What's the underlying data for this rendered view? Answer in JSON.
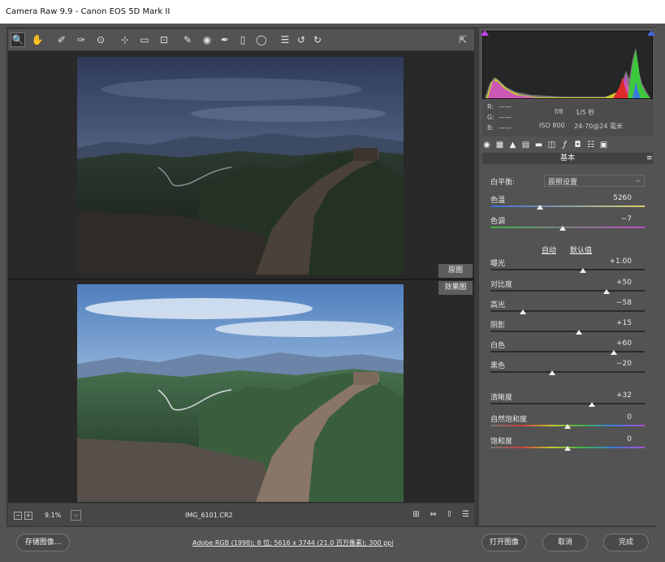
{
  "title": {
    "app": "Camera Raw 9.9",
    "separator": " - ",
    "camera": "Canon EOS 5D Mark II"
  },
  "toolbar": {
    "tools": [
      "zoom-tool-icon",
      "hand-tool-icon",
      "white-balance-tool-icon",
      "color-sampler-icon",
      "targeted-adjustment-icon",
      "crop-tool-icon",
      "straighten-tool-icon",
      "transform-tool-icon",
      "spot-removal-icon",
      "red-eye-icon",
      "adjustment-brush-icon",
      "graduated-filter-icon",
      "radial-filter-icon",
      "preferences-icon",
      "rotate-ccw-icon",
      "rotate-cw-icon"
    ],
    "glyphs": [
      "🔍",
      "✋",
      "✐",
      "✑",
      "⊙",
      "⊹",
      "▭",
      "⊡",
      "✎",
      "◉",
      "✒",
      "▯",
      "◯",
      "☰",
      "↺",
      "↻"
    ]
  },
  "preview": {
    "before_label": "原图",
    "after_label": "效果图"
  },
  "statusbar": {
    "zoom_minus": "−",
    "zoom_plus": "+",
    "zoom": "9.1%",
    "filename": "IMG_6101.CR2"
  },
  "histogram": {
    "readouts": {
      "r": "R:",
      "g": "G:",
      "b": "B:",
      "dash": "——"
    }
  },
  "camera_info": {
    "aperture": "f/8",
    "shutter": "1/5 秒",
    "iso": "ISO 800",
    "lens": "24-70@24 毫米"
  },
  "basic": {
    "section_title": "基本",
    "white_balance_label": "白平衡:",
    "white_balance_value": "原照设置",
    "auto": "自动",
    "default": "默认值",
    "sliders": [
      {
        "label": "色温",
        "value": "5260",
        "fraction": 0.32,
        "track": "temp"
      },
      {
        "label": "色调",
        "value": "−7",
        "fraction": 0.47,
        "track": "tint"
      },
      {
        "label": "曝光",
        "value": "+1.00",
        "fraction": 0.6,
        "track": "plain"
      },
      {
        "label": "对比度",
        "value": "+50",
        "fraction": 0.75,
        "track": "plain"
      },
      {
        "label": "高光",
        "value": "−58",
        "fraction": 0.21,
        "track": "plain"
      },
      {
        "label": "阴影",
        "value": "+15",
        "fraction": 0.575,
        "track": "plain"
      },
      {
        "label": "白色",
        "value": "+60",
        "fraction": 0.8,
        "track": "plain"
      },
      {
        "label": "黑色",
        "value": "−20",
        "fraction": 0.4,
        "track": "plain"
      },
      {
        "label": "清晰度",
        "value": "+32",
        "fraction": 0.66,
        "track": "plain"
      },
      {
        "label": "自然饱和度",
        "value": "0",
        "fraction": 0.5,
        "track": "rainbow"
      },
      {
        "label": "饱和度",
        "value": "0",
        "fraction": 0.5,
        "track": "rainbow"
      }
    ]
  },
  "footer": {
    "save": "存储图像...",
    "color_info": "Adobe RGB (1998); 8 位; 5616 x 3744 (21.0 百万像素); 300 ppi",
    "open": "打开图像",
    "cancel": "取消",
    "done": "完成"
  },
  "colors": {
    "accent": "#bb44ee",
    "panel": "#535353",
    "preview_bg": "#292929"
  }
}
